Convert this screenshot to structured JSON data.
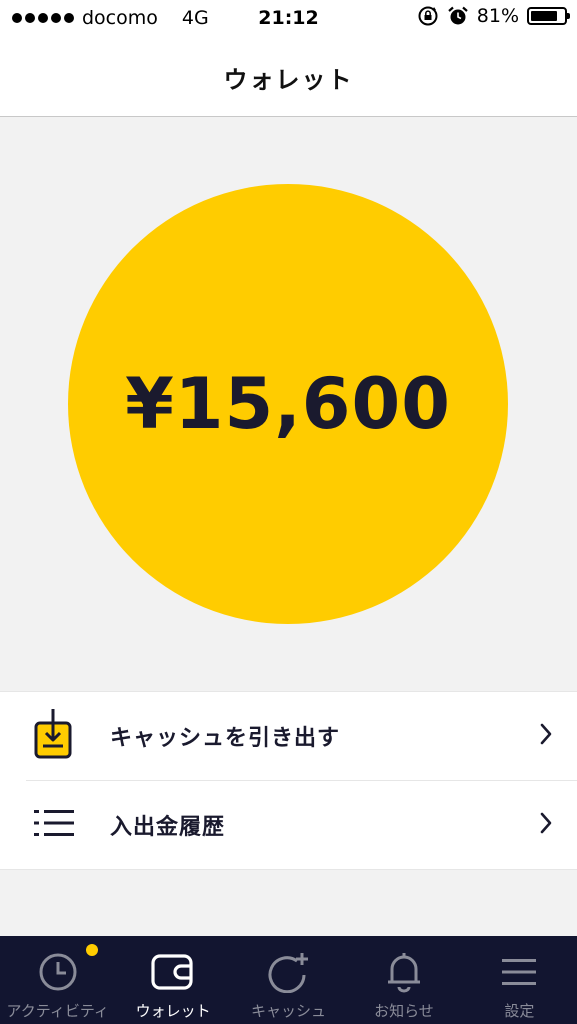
{
  "status_bar": {
    "carrier": "docomo",
    "network": "4G",
    "time": "21:12",
    "battery_text": "81%",
    "battery_level": 0.81
  },
  "nav": {
    "title": "ウォレット"
  },
  "balance": {
    "amount": "¥15,600"
  },
  "menu": {
    "items": [
      {
        "label": "キャッシュを引き出す",
        "icon": "withdraw-icon"
      },
      {
        "label": "入出金履歴",
        "icon": "list-icon"
      }
    ]
  },
  "tabs": [
    {
      "label": "アクティビティ",
      "icon": "clock-icon",
      "active": false,
      "badge": true
    },
    {
      "label": "ウォレット",
      "icon": "wallet-icon",
      "active": true,
      "badge": false
    },
    {
      "label": "キャッシュ",
      "icon": "cash-add-icon",
      "active": false,
      "badge": false
    },
    {
      "label": "お知らせ",
      "icon": "bell-icon",
      "active": false,
      "badge": false
    },
    {
      "label": "設定",
      "icon": "menu-icon",
      "active": false,
      "badge": false
    }
  ],
  "colors": {
    "accent": "#ffcc00",
    "tab_bar_bg": "#121530",
    "text_dark": "#1a1a2e",
    "background": "#f2f2f2"
  }
}
